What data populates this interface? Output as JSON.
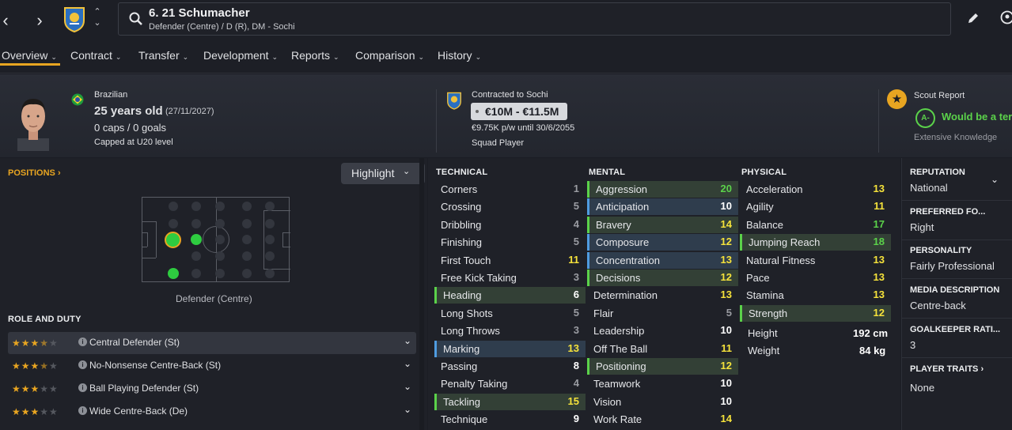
{
  "header": {
    "title": "6. 21 Schumacher",
    "subtitle": "Defender (Centre) / D (R), DM - Sochi"
  },
  "tabs": [
    {
      "label": "Overview"
    },
    {
      "label": "Contract"
    },
    {
      "label": "Transfer"
    },
    {
      "label": "Development"
    },
    {
      "label": "Reports"
    },
    {
      "label": "Comparison"
    },
    {
      "label": "History"
    }
  ],
  "profile": {
    "nationality": "Brazilian",
    "age": "25 years old",
    "dob": "(27/11/2027)",
    "caps": "0 caps / 0 goals",
    "capped": "Capped at U20 level"
  },
  "contract": {
    "status": "Contracted to Sochi",
    "value": "€10M - €11.5M",
    "wage": "€9.75K p/w until 30/6/2055",
    "role": "Squad Player"
  },
  "scout": {
    "title": "Scout Report",
    "grade": "A-",
    "verdict": "Would be a terr",
    "knowledge": "Extensive Knowledge"
  },
  "positions": {
    "heading": "POSITIONS",
    "highlight": "Highlight",
    "label": "Defender (Centre)"
  },
  "roles": {
    "heading": "ROLE AND DUTY",
    "items": [
      {
        "name": "Central Defender (St)",
        "stars": 3.5
      },
      {
        "name": "No-Nonsense Centre-Back (St)",
        "stars": 3.5
      },
      {
        "name": "Ball Playing Defender (St)",
        "stars": 3
      },
      {
        "name": "Wide Centre-Back (De)",
        "stars": 3
      }
    ]
  },
  "technical": {
    "heading": "TECHNICAL",
    "items": [
      {
        "name": "Corners",
        "value": "1"
      },
      {
        "name": "Crossing",
        "value": "5"
      },
      {
        "name": "Dribbling",
        "value": "4"
      },
      {
        "name": "Finishing",
        "value": "5"
      },
      {
        "name": "First Touch",
        "value": "11"
      },
      {
        "name": "Free Kick Taking",
        "value": "3"
      },
      {
        "name": "Heading",
        "value": "6"
      },
      {
        "name": "Long Shots",
        "value": "5"
      },
      {
        "name": "Long Throws",
        "value": "3"
      },
      {
        "name": "Marking",
        "value": "13"
      },
      {
        "name": "Passing",
        "value": "8"
      },
      {
        "name": "Penalty Taking",
        "value": "4"
      },
      {
        "name": "Tackling",
        "value": "15"
      },
      {
        "name": "Technique",
        "value": "9"
      }
    ]
  },
  "mental": {
    "heading": "MENTAL",
    "items": [
      {
        "name": "Aggression",
        "value": "20"
      },
      {
        "name": "Anticipation",
        "value": "10"
      },
      {
        "name": "Bravery",
        "value": "14"
      },
      {
        "name": "Composure",
        "value": "12"
      },
      {
        "name": "Concentration",
        "value": "13"
      },
      {
        "name": "Decisions",
        "value": "12"
      },
      {
        "name": "Determination",
        "value": "13"
      },
      {
        "name": "Flair",
        "value": "5"
      },
      {
        "name": "Leadership",
        "value": "10"
      },
      {
        "name": "Off The Ball",
        "value": "11"
      },
      {
        "name": "Positioning",
        "value": "12"
      },
      {
        "name": "Teamwork",
        "value": "10"
      },
      {
        "name": "Vision",
        "value": "10"
      },
      {
        "name": "Work Rate",
        "value": "14"
      }
    ]
  },
  "physical": {
    "heading": "PHYSICAL",
    "items": [
      {
        "name": "Acceleration",
        "value": "13"
      },
      {
        "name": "Agility",
        "value": "11"
      },
      {
        "name": "Balance",
        "value": "17"
      },
      {
        "name": "Jumping Reach",
        "value": "18"
      },
      {
        "name": "Natural Fitness",
        "value": "13"
      },
      {
        "name": "Pace",
        "value": "13"
      },
      {
        "name": "Stamina",
        "value": "13"
      },
      {
        "name": "Strength",
        "value": "12"
      }
    ],
    "height_label": "Height",
    "height": "192 cm",
    "weight_label": "Weight",
    "weight": "84 kg"
  },
  "info": {
    "reputation_label": "REPUTATION",
    "reputation": "National",
    "foot_label": "PREFERRED FO...",
    "foot": "Right",
    "personality_label": "PERSONALITY",
    "personality": "Fairly Professional",
    "media_label": "MEDIA DESCRIPTION",
    "media": "Centre-back",
    "gk_label": "GOALKEEPER RATI...",
    "gk": "3",
    "traits_label": "PLAYER TRAITS",
    "traits": "None"
  },
  "colors": {
    "accent": "#e8a521",
    "green": "#5bd24a",
    "yellow": "#f5e23b",
    "white": "#ffffff",
    "grey": "#9a9ca2"
  }
}
